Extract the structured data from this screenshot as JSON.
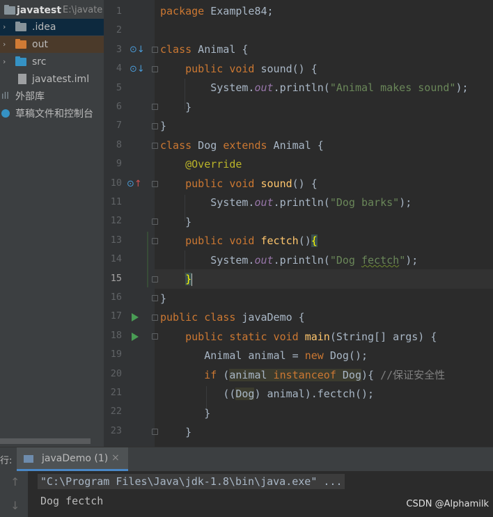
{
  "project": {
    "name": "javatest",
    "path": "E:\\javate",
    "items": [
      {
        "label": ".idea",
        "kind": "folder",
        "color": "#87939a"
      },
      {
        "label": "out",
        "kind": "folder",
        "color": "#d17b35"
      },
      {
        "label": "src",
        "kind": "folder",
        "color": "#3592c4"
      },
      {
        "label": "javatest.iml",
        "kind": "file"
      }
    ],
    "external_libs": "外部库",
    "scratches": "草稿文件和控制台"
  },
  "editor": {
    "current_line": 15,
    "line_numbers": [
      "1",
      "2",
      "3",
      "4",
      "5",
      "6",
      "7",
      "8",
      "9",
      "10",
      "11",
      "12",
      "13",
      "14",
      "15",
      "16",
      "17",
      "18",
      "19",
      "20",
      "21",
      "22",
      "23"
    ],
    "t": {
      "package": "package",
      "pkg": " Example84;",
      "class": "class",
      "Animal": " Animal {",
      "public": "public",
      "void": " void ",
      "sound": "sound",
      "sound_parens": "() {",
      "sysout": "System.",
      "out": "out",
      "println": ".println(",
      "animal_str": "\"Animal makes sound\"",
      "animal_end": ");",
      "close": "}",
      "Dog": " Dog ",
      "extends": "extends",
      "Animal2": " Animal {",
      "override": "@Override",
      "dog_barks": "\"Dog barks\"",
      "dog_end": ");",
      "fectch": "fectch",
      "parens": "()",
      "open_brace": "{",
      "dog_fectch_q": "\"Dog ",
      "dog_fectch_w": "fectch",
      "dog_fectch_e": "\"",
      "dog_fectch_end": ");",
      "close_cur": "}",
      "public_class": "public class",
      "javaDemo": " javaDemo {",
      "public_static_void": "public static void ",
      "main": "main",
      "main_args": "(String[] args) {",
      "animal_decl": "Animal animal = ",
      "new": "new",
      "new_dog": " Dog();",
      "if": "if",
      "if_open": " (",
      "animal_ref": "animal",
      "instanceof": " instanceof",
      "dog_t": " Dog",
      "if_close": "){ ",
      "comment": "//保证安全性",
      "cast_open": "((",
      "cast_dog": "Dog",
      "cast_rest": ") animal).fectch();",
      "close2": "}",
      "close3": "}"
    }
  },
  "run_panel": {
    "label": "行:",
    "tab": "javaDemo (1)",
    "tab_close": "×",
    "command": "\"C:\\Program Files\\Java\\jdk-1.8\\bin\\java.exe\" ...",
    "output": "Dog fectch",
    "watermark": "CSDN @Alphamilk"
  }
}
